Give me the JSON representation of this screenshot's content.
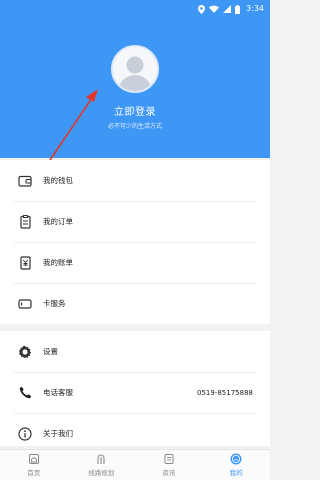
{
  "status_bar": {
    "time": "3:34"
  },
  "header": {
    "login_title": "立即登录",
    "login_subtitle": "必不可少的生活方式"
  },
  "menu_group_1": [
    {
      "label": "我的钱包",
      "icon": "wallet-icon"
    },
    {
      "label": "我的订单",
      "icon": "order-icon"
    },
    {
      "label": "我的账单",
      "icon": "bill-icon"
    },
    {
      "label": "卡服务",
      "icon": "card-icon"
    }
  ],
  "menu_group_2": [
    {
      "label": "设置",
      "icon": "gear-icon",
      "value": ""
    },
    {
      "label": "电话客服",
      "icon": "phone-icon",
      "value": "0519-85175888"
    },
    {
      "label": "关于我们",
      "icon": "info-icon",
      "value": ""
    }
  ],
  "tabs": [
    {
      "label": "首页",
      "icon": "home-icon",
      "active": false
    },
    {
      "label": "线路规划",
      "icon": "route-icon",
      "active": false
    },
    {
      "label": "资讯",
      "icon": "news-icon",
      "active": false
    },
    {
      "label": "我的",
      "icon": "profile-icon",
      "active": true
    }
  ],
  "colors": {
    "accent": "#3f97f5",
    "annotation_arrow": "#e0362c"
  }
}
